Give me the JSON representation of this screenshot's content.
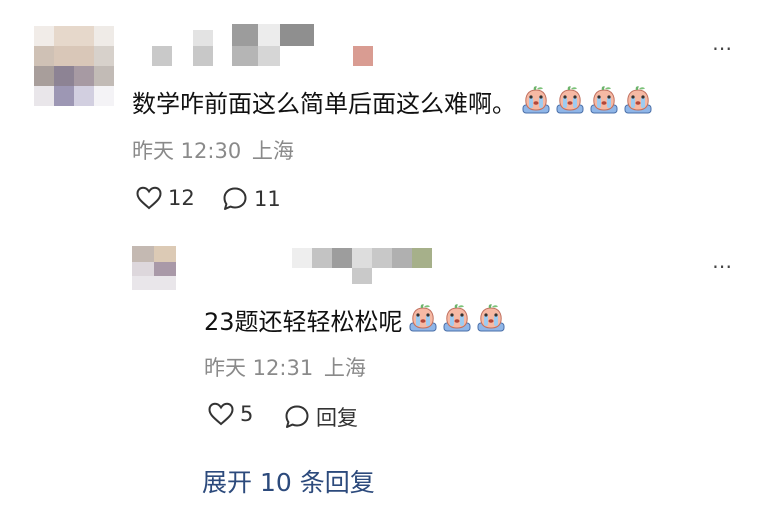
{
  "colors": {
    "meta_gray": "#8a8a8a",
    "link_blue": "#2c4a7c",
    "text": "#111111"
  },
  "comment": {
    "text": "数学咋前面这么简单后面这么难啊。",
    "emoji_icon": "crying-peach-emoji",
    "emoji_count": 4,
    "time": "昨天 12:30",
    "location": "上海",
    "likes": "12",
    "replies": "11",
    "more_icon": "ellipsis-icon"
  },
  "reply": {
    "text": "23题还轻轻松松呢",
    "emoji_icon": "crying-peach-emoji",
    "emoji_count": 3,
    "time": "昨天 12:31",
    "location": "上海",
    "likes": "5",
    "reply_label": "回复",
    "more_icon": "ellipsis-icon"
  },
  "expand_label": "展开 10 条回复"
}
